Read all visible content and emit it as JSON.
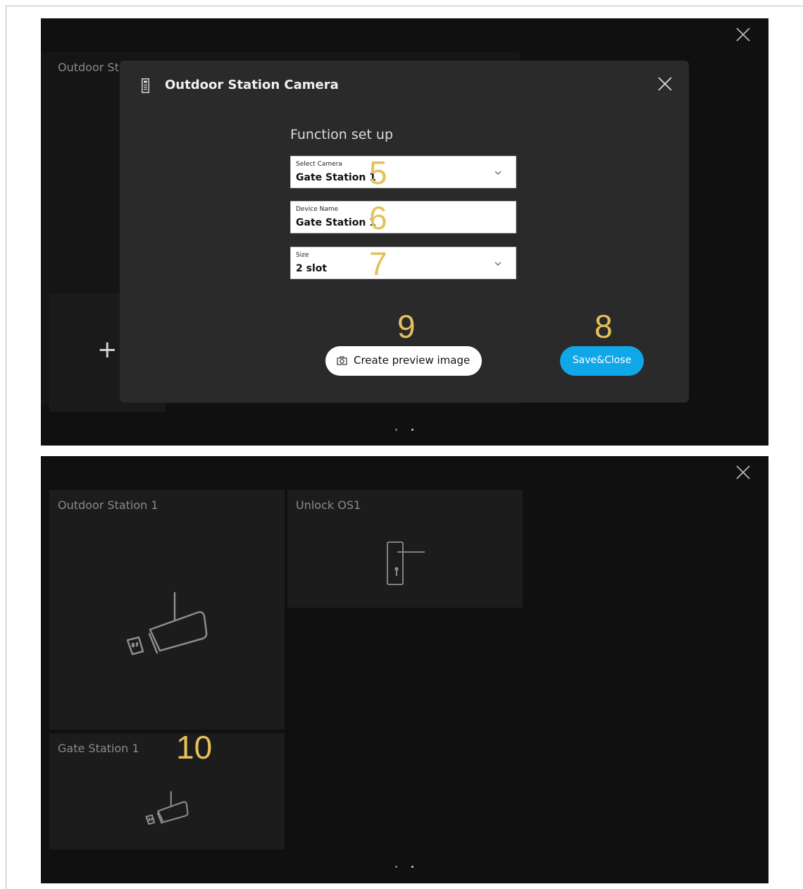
{
  "screen1": {
    "bg_tile_label": "Outdoor St",
    "add_symbol": "+",
    "dialog": {
      "title": "Outdoor Station Camera",
      "section_title": "Function set up",
      "fields": {
        "camera": {
          "label": "Select Camera",
          "value": "Gate Station 1",
          "annotation": "5"
        },
        "name": {
          "label": "Device Name",
          "value": "Gate Station 1",
          "annotation": "6"
        },
        "size": {
          "label": "Size",
          "value": "2 slot",
          "annotation": "7"
        }
      },
      "preview_button": {
        "label": "Create preview image",
        "annotation": "9"
      },
      "save_button": {
        "label": "Save&Close",
        "annotation": "8"
      }
    }
  },
  "screen2": {
    "tiles": {
      "outdoor_station": {
        "label": "Outdoor Station 1"
      },
      "unlock": {
        "label": "Unlock OS1"
      },
      "gate_station": {
        "label": "Gate Station  1",
        "annotation": "10"
      }
    }
  },
  "colors": {
    "accent": "#10a7e8",
    "annotation": "#e5c15a",
    "screen_bg": "#101010",
    "tile_bg": "#1c1c1c",
    "dialog_bg": "#2a2a2a"
  },
  "icons": [
    "close-icon",
    "intercom-device-icon",
    "chevron-down-icon",
    "camera-icon",
    "security-camera-icon",
    "door-handle-icon",
    "plus-icon"
  ]
}
